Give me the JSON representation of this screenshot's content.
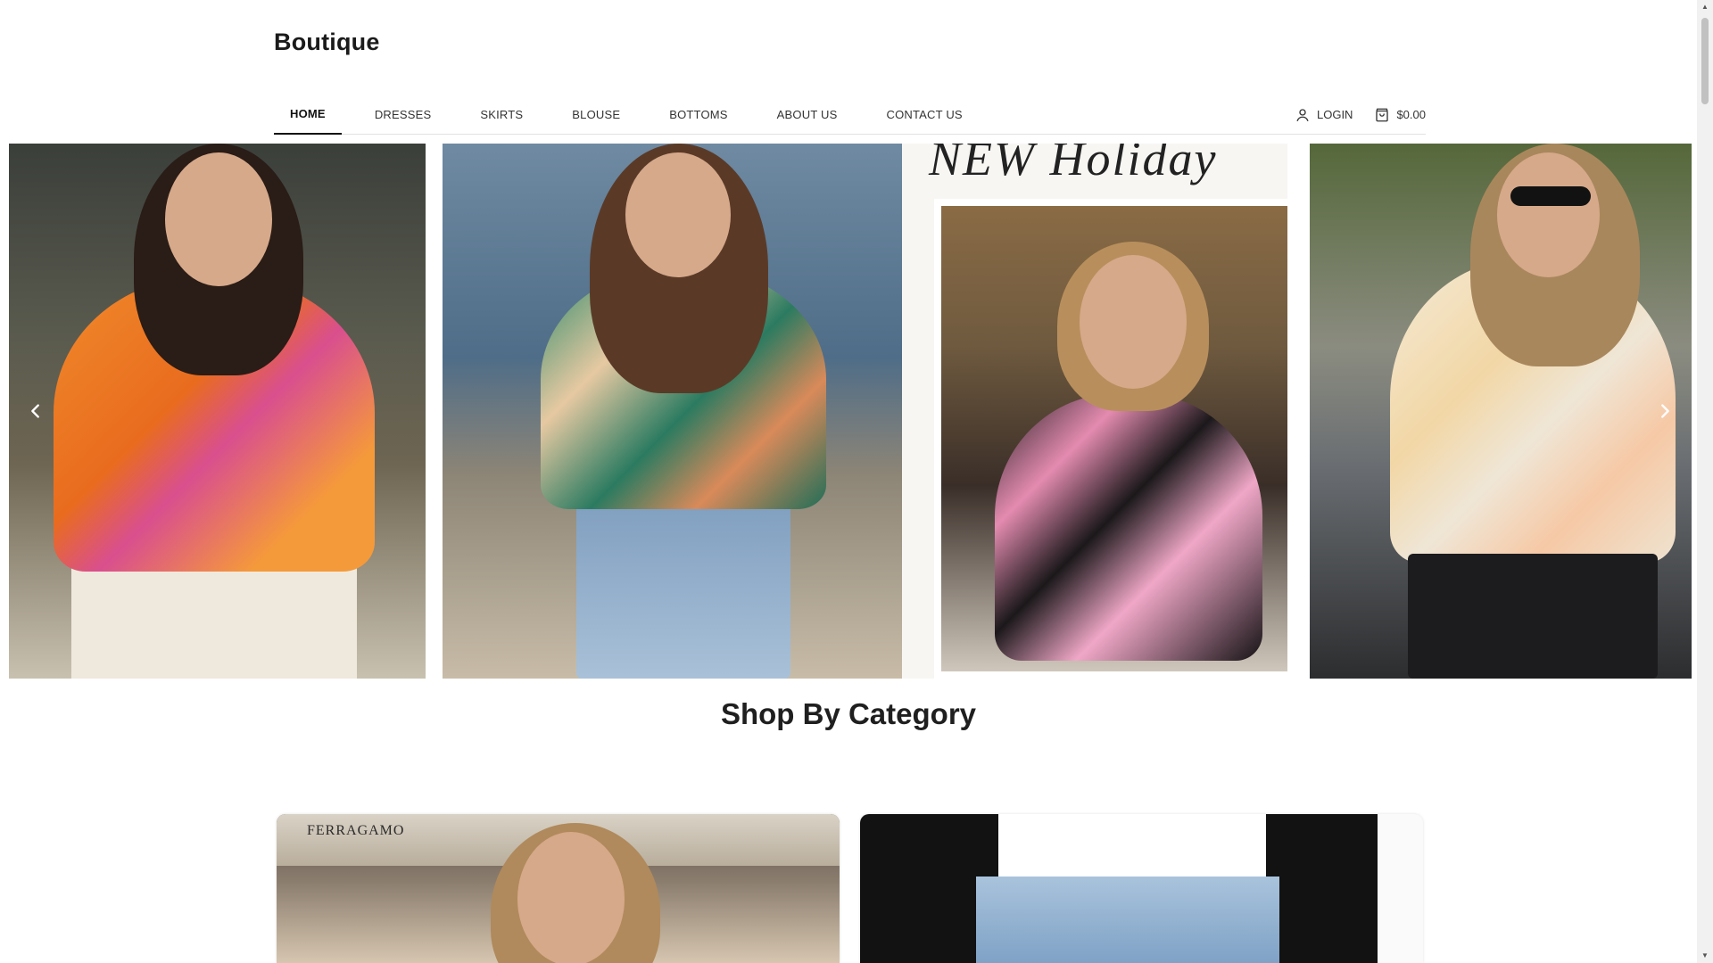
{
  "header": {
    "logo": "Boutique"
  },
  "nav": {
    "items": [
      {
        "label": "HOME",
        "active": true
      },
      {
        "label": "DRESSES",
        "active": false
      },
      {
        "label": "SKIRTS",
        "active": false
      },
      {
        "label": "BLOUSE",
        "active": false
      },
      {
        "label": "BOTTOMS",
        "active": false
      },
      {
        "label": "ABOUT US",
        "active": false
      },
      {
        "label": "CONTACT US",
        "active": false
      }
    ],
    "login_label": "LOGIN",
    "cart_total": "$0.00"
  },
  "hero": {
    "holiday_text": "NEW Holiday",
    "slides": [
      {
        "icon": "model-orange-floral-blouse"
      },
      {
        "icon": "model-green-floral-blouse"
      },
      {
        "icon": "model-black-floral-blouse"
      },
      {
        "icon": "model-cream-floral-blouse"
      }
    ]
  },
  "section": {
    "title": "Shop By Category"
  },
  "categories": [
    {
      "label": "FERRAGAMO"
    },
    {
      "label": ""
    }
  ],
  "colors": {
    "text": "#111111",
    "nav_active_underline": "#111111",
    "divider": "#e2e2e2"
  }
}
